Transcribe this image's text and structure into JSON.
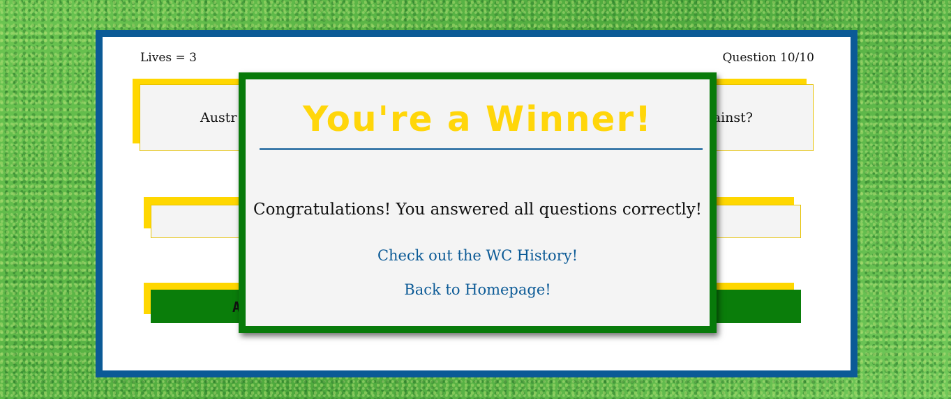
{
  "hud": {
    "lives": "Lives = 3",
    "question_counter": "Question 10/10"
  },
  "question": {
    "text_left_visible": "Austr",
    "text_right_visible": "ainst?"
  },
  "answers": [
    {
      "label": "",
      "state": "neutral"
    },
    {
      "label": "A",
      "state": "correct"
    }
  ],
  "modal": {
    "title": "You're a Winner!",
    "message": "Congratulations! You answered all questions correctly!",
    "history_link": "Check out the WC History!",
    "home_link": "Back to Homepage!"
  },
  "colors": {
    "frame_border": "#0b5a96",
    "accent_yellow": "#ffd700",
    "correct_green": "#0a7d0a",
    "modal_border": "#087a0a",
    "link": "#0b5a96"
  }
}
